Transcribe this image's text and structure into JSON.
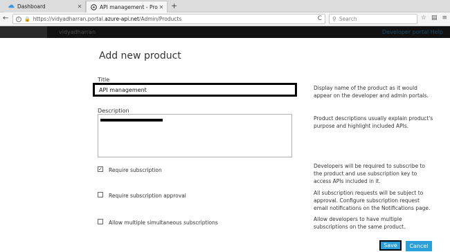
{
  "browser": {
    "tabs": [
      {
        "label": "Dashboard",
        "active": false
      },
      {
        "label": "API management - Products",
        "active": true
      }
    ],
    "url_prefix": "https://vidyadharran.portal.",
    "url_domain": "azure-api.net",
    "url_suffix": "/Admin/Products",
    "search_placeholder": "Search",
    "new_tab_glyph": "+",
    "back_glyph": "←",
    "reload_glyph": "C",
    "close_glyph": "✕"
  },
  "portal": {
    "user": "vidyadharran",
    "links": "Developer portal    Help"
  },
  "form": {
    "heading": "Add new product",
    "title_label": "Title",
    "title_value": "API management",
    "title_help": "Display name of the product as it would appear on the developer and admin portals.",
    "description_label": "Description",
    "description_help": "Product descriptions usually explain product's purpose and highlight included APIs.",
    "require_subscription": {
      "label": "Require subscription",
      "checked": true
    },
    "require_subscription_help": "Developers will be required to subscribe to the product and use subscription key to access APIs included in it.",
    "require_approval": {
      "label": "Require subscription approval",
      "checked": false
    },
    "require_approval_help": "All subscription requests will be subject to approval. Configure subscription request email notifications on the Notifications page.",
    "allow_multiple": {
      "label": "Allow multiple simultaneous subscriptions",
      "checked": false
    },
    "allow_multiple_help": "Allow developers to have multiple subscriptions on the same product.",
    "save_label": "Save",
    "cancel_label": "Cancel",
    "check_glyph": "✓"
  },
  "colors": {
    "accent": "#2b9fd9",
    "portal_header": "#121212"
  }
}
